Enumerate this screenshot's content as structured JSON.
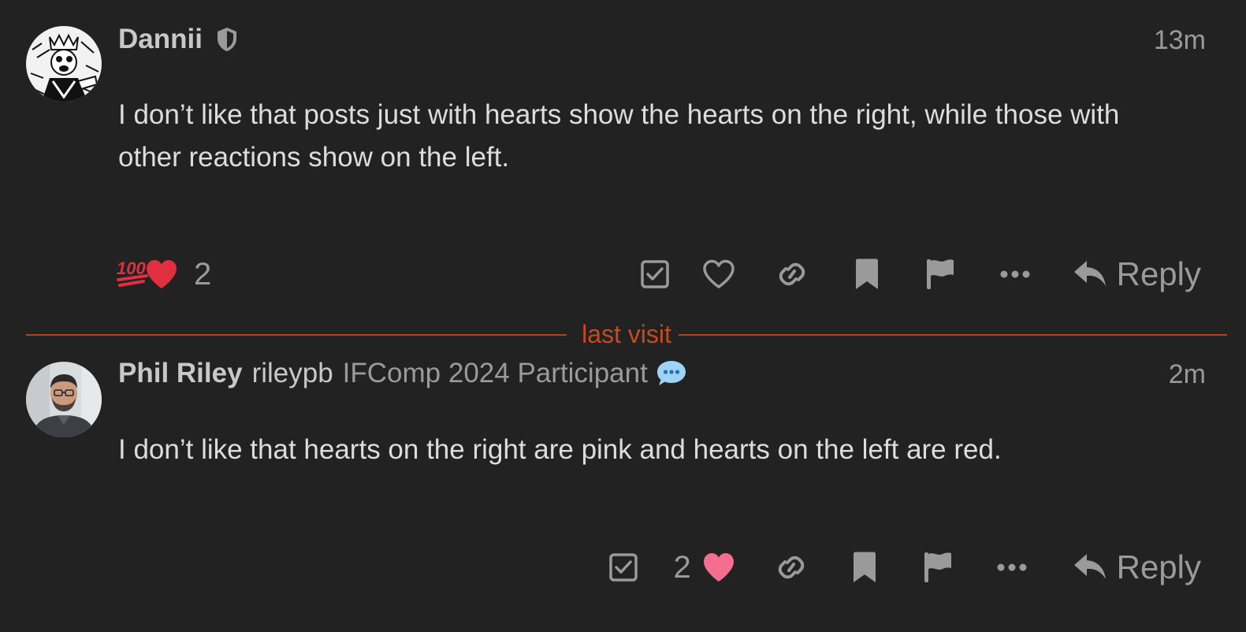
{
  "posts": [
    {
      "author_name": "Dannii",
      "author_badge_icon": "shield-icon",
      "time": "13m",
      "body": "I don’t like that posts just with hearts show the hearts on the right, while those with other reactions show on the left.",
      "reactions": {
        "icons": [
          "hundred-points-icon",
          "red-heart-icon"
        ],
        "count": "2"
      },
      "actions": {
        "reply_label": "Reply"
      }
    },
    {
      "author_name": "Phil Riley",
      "username": "rileypb",
      "user_title": "IFComp 2024 Participant",
      "flair_icon": "speech-bubble-icon",
      "time": "2m",
      "body": "I don’t like that hearts on the right are pink and hearts on the left are red.",
      "like_count": "2",
      "actions": {
        "reply_label": "Reply"
      }
    }
  ],
  "divider": {
    "label": "last visit"
  },
  "colors": {
    "background": "#222222",
    "divider": "#b8411c",
    "red_heart": "#e0303f",
    "pink_heart": "#f56e8f",
    "flair": "#9fd3f5"
  }
}
